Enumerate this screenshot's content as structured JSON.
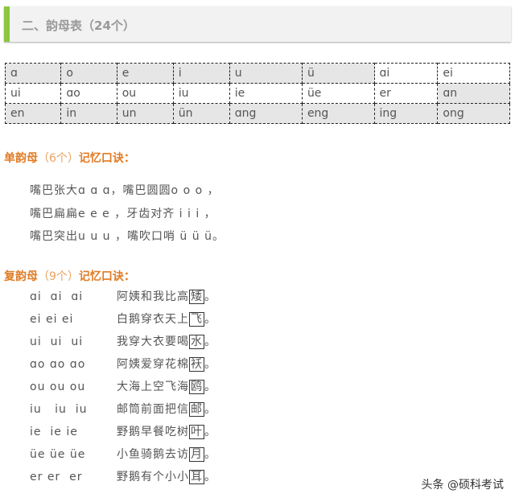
{
  "header": {
    "title": "二、韵母表（24个）"
  },
  "table": {
    "rows": [
      [
        "ɑ",
        "o",
        "e",
        "i",
        "u",
        "ü",
        "ɑi",
        "ei"
      ],
      [
        "ui",
        "ɑo",
        "ou",
        "iu",
        "ie",
        "üe",
        "er",
        "ɑn"
      ],
      [
        "en",
        "in",
        "un",
        "ün",
        "ɑng",
        "eng",
        "ing",
        "ong"
      ]
    ]
  },
  "single": {
    "title": "单韵母",
    "count": "（6个）",
    "suffix": "记忆口诀：",
    "lines": [
      "嘴巴张大ɑ ɑ ɑ，嘴巴圆圆o o o ，",
      "嘴巴扁扁e e e ，牙齿对齐 i i i ，",
      "嘴巴突出u u u ，嘴吹口哨 ü ü ü。"
    ]
  },
  "compound": {
    "title": "复韵母",
    "count": "（9个）",
    "suffix": "记忆口诀：",
    "items": [
      {
        "py": "ɑi  ɑi  ɑi",
        "text": "阿姨和我比高",
        "key": "矮"
      },
      {
        "py": "ei ei ei",
        "text": "白鹅穿衣天上",
        "key": "飞"
      },
      {
        "py": "ui  ui  ui",
        "text": "我穿大衣要喝",
        "key": "水"
      },
      {
        "py": "ɑo ɑo ɑo",
        "text": "阿姨爱穿花棉",
        "key": "袄"
      },
      {
        "py": "ou ou ou",
        "text": "大海上空飞海",
        "key": "鸥"
      },
      {
        "py": "iu   iu  iu",
        "text": "邮筒前面把信",
        "key": "邮"
      },
      {
        "py": "ie  ie ie",
        "text": "野鹅早餐吃树",
        "key": "叶"
      },
      {
        "py": "üe üe üe",
        "text": "小鱼骑鹅去访",
        "key": "月"
      },
      {
        "py": "er er  er",
        "text": "野鹅有个小小",
        "key": "耳"
      }
    ]
  },
  "watermark": "头条 @硕科考试"
}
